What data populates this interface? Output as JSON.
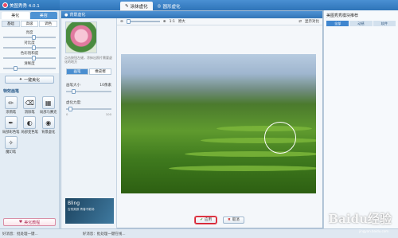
{
  "app": {
    "title": "美图秀秀 4.0.1",
    "dialog_title": "背景虚化",
    "top_tab1": "涂抹虚化",
    "top_tab2": "圆形虚化"
  },
  "sidebar": {
    "tabs": [
      "美化",
      "美容"
    ],
    "subtabs": [
      "基础",
      "高级",
      "调色"
    ],
    "sliders": [
      {
        "label": "亮度",
        "value": 0.55
      },
      {
        "label": "对比度",
        "value": 0.55
      },
      {
        "label": "色彩饱和度",
        "value": 0.55
      },
      {
        "label": "清晰度",
        "value": 0.2
      }
    ],
    "onekey_label": "一键美化",
    "section": "特效画笔",
    "tools": [
      {
        "label": "涂鸦笔",
        "icon": "pen-icon"
      },
      {
        "label": "消除笔",
        "icon": "eraser-icon"
      },
      {
        "label": "局部马赛克",
        "icon": "mosaic-icon"
      },
      {
        "label": "局部彩色笔",
        "icon": "color-pen-icon"
      },
      {
        "label": "局部变色笔",
        "icon": "recolor-icon"
      },
      {
        "label": "背景虚化",
        "icon": "blur-icon"
      },
      {
        "label": "魔幻笔",
        "icon": "magic-icon"
      }
    ],
    "beauty_btn": "美化教程"
  },
  "dialog": {
    "hint": "点击按钮左键，涂抹出照片需要虚化的地方",
    "mode_tabs": [
      "画笔",
      "橡皮擦"
    ],
    "brush_size_label": "画笔大小",
    "brush_size_value": "10像素",
    "blur_label": "虚化力度:",
    "blur_low": "0",
    "blur_high": "100",
    "toolbar_zoom": "1:1",
    "toolbar_original": "原大",
    "toolbar_compare": "显示对比",
    "ok_label": "应用",
    "cancel_label": "取消",
    "promo_title": "Bling",
    "promo_sub": "告别美颜 青春不散场"
  },
  "rpanel": {
    "title": "美图秀秀模块推荐",
    "tabs": [
      "全部",
      "动感",
      "软件"
    ]
  },
  "status": {
    "left": "好消息：批处理一键...",
    "right": "好消息：批处理一键在线..."
  },
  "watermark": "Baidu经验",
  "watermark_sub": "jingyan.baidu.com"
}
